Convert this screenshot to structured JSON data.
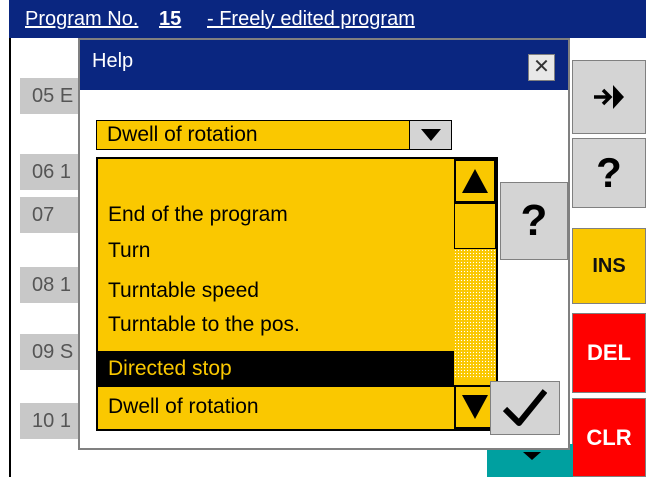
{
  "header": {
    "label": "Program No.",
    "number": "15",
    "description": "- Freely edited program"
  },
  "rows": [
    {
      "num": "05",
      "ch": "E"
    },
    {
      "num": "06",
      "ch": "1"
    },
    {
      "num": "07",
      "ch": ""
    },
    {
      "num": "08",
      "ch": "1"
    },
    {
      "num": "09",
      "ch": "S"
    },
    {
      "num": "10",
      "ch": "1"
    }
  ],
  "side_buttons": {
    "enter_icon": "enter-arrow-icon",
    "help_label": "?",
    "ins_label": "INS",
    "del_label": "DEL",
    "clr_label": "CLR"
  },
  "dialog": {
    "title": "Help",
    "close_label": "✕",
    "combo_value": "Dwell of rotation",
    "list_items": [
      "",
      "End of the program",
      "Turn",
      "Turntable speed",
      "Turntable to the pos.",
      "",
      "Directed stop",
      "Dwell of rotation"
    ],
    "selected_index": 6,
    "help_button_label": "?",
    "ok_icon": "check-icon"
  },
  "colors": {
    "title_bg": "#0a2680",
    "accent": "#fac800",
    "alert": "#ff0000",
    "teal": "#00a0a0"
  }
}
